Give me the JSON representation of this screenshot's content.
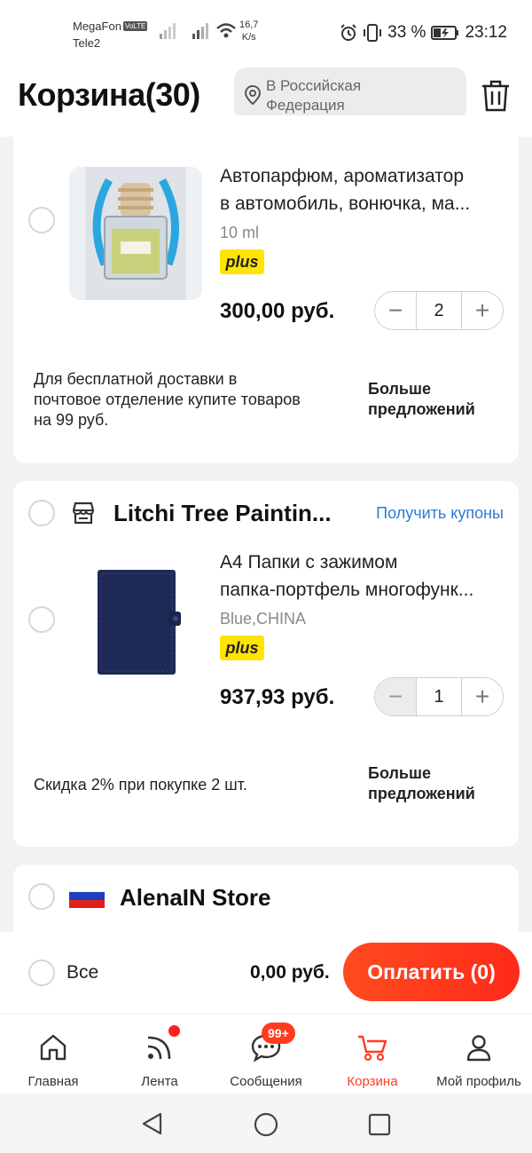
{
  "status_bar": {
    "carrier1": "MegaFon",
    "volte": "VoLTE",
    "carrier2": "Tele2",
    "net_speed_value": "16,7",
    "net_speed_unit": "K/s",
    "battery": "33 %",
    "time": "23:12"
  },
  "header": {
    "title": "Корзина(30)",
    "location_line1": "В Российская",
    "location_line2": "Федерация"
  },
  "card1": {
    "product": {
      "name_line1": "Автопарфюм, ароматизатор",
      "name_line2": "в автомобиль, вонючка, ма...",
      "variant": "10 ml",
      "plus": "plus",
      "price": "300,00 руб.",
      "quantity": "2"
    },
    "promo_line1": "Для бесплатной доставки в",
    "promo_line2": "почтовое отделение купите товаров",
    "promo_line3": "на 99 руб.",
    "more_line1": "Больше",
    "more_line2": "предложений"
  },
  "card2": {
    "store_name": "Litchi Tree Paintin...",
    "coupons": "Получить купоны",
    "product": {
      "name_line1": "A4 Папки с зажимом",
      "name_line2": "папка-портфель многофунк...",
      "variant": "Blue,CHINA",
      "plus": "plus",
      "price": "937,93 руб.",
      "quantity": "1"
    },
    "promo": "Скидка 2% при покупке 2 шт.",
    "more_line1": "Больше",
    "more_line2": "предложений"
  },
  "card3": {
    "store_name": "AlenaIN Store"
  },
  "checkout": {
    "all_label": "Все",
    "total": "0,00 руб.",
    "pay_label": "Оплатить (0)"
  },
  "tabs": [
    {
      "label": "Главная",
      "icon": "home-icon"
    },
    {
      "label": "Лента",
      "icon": "feed-icon"
    },
    {
      "label": "Сообщения",
      "icon": "messages-icon",
      "badge": "99+"
    },
    {
      "label": "Корзина",
      "icon": "cart-icon",
      "active": true
    },
    {
      "label": "Мой профиль",
      "icon": "profile-icon"
    }
  ],
  "colors": {
    "accent": "#ff3b1f",
    "link": "#2d7bd4",
    "plus_badge": "#ffe500"
  }
}
